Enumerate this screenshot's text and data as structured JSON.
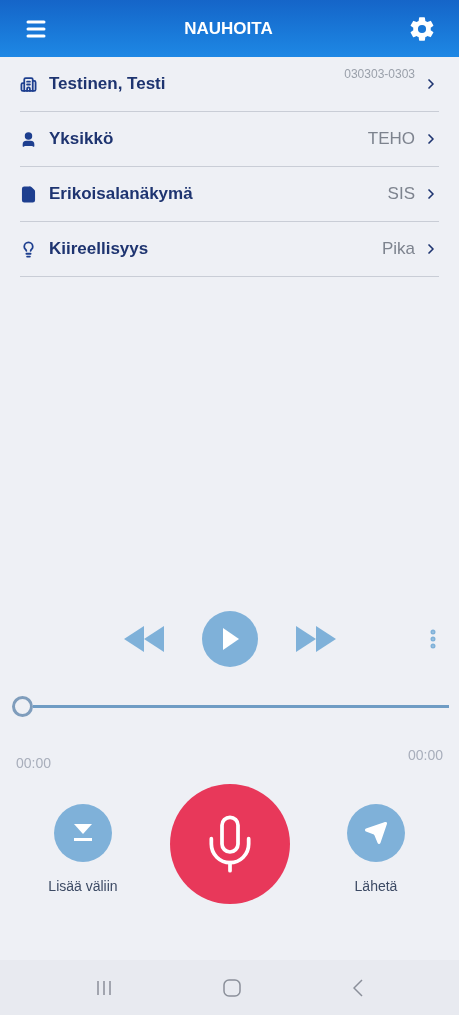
{
  "header": {
    "title": "NAUHOITA"
  },
  "rows": [
    {
      "kind": "patient",
      "label": "Testinen, Testi",
      "value": "030303-0303"
    },
    {
      "kind": "setting",
      "label": "Yksikkö",
      "value": "TEHO"
    },
    {
      "kind": "setting",
      "label": "Erikoisalanäkymä",
      "value": "SIS"
    },
    {
      "kind": "setting",
      "label": "Kiireellisyys",
      "value": "Pika"
    }
  ],
  "player": {
    "level": 0,
    "elapsed": "00:00",
    "total": "00:00"
  },
  "actions": [
    {
      "kind": "insert",
      "label": "Lisää väliin"
    },
    {
      "kind": "record"
    },
    {
      "kind": "send",
      "label": "Lähetä"
    }
  ]
}
